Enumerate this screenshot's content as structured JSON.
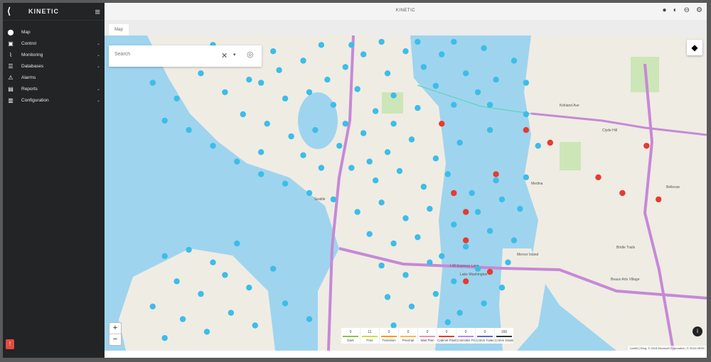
{
  "app": {
    "brand": "KINETIC",
    "title": "KINETIC"
  },
  "sidebar": {
    "items": [
      {
        "label": "Map",
        "icon": "map-pin-icon",
        "glyph": "⬤",
        "chevron": false
      },
      {
        "label": "Control",
        "icon": "control-icon",
        "glyph": "▣",
        "chevron": true
      },
      {
        "label": "Monitoring",
        "icon": "monitoring-icon",
        "glyph": "⌇",
        "chevron": true
      },
      {
        "label": "Databases",
        "icon": "database-icon",
        "glyph": "☰",
        "chevron": true
      },
      {
        "label": "Alarms",
        "icon": "alarm-icon",
        "glyph": "⚠",
        "chevron": false
      },
      {
        "label": "Reports",
        "icon": "report-icon",
        "glyph": "▤",
        "chevron": true
      },
      {
        "label": "Configuration",
        "icon": "configuration-icon",
        "glyph": "▥",
        "chevron": true
      }
    ]
  },
  "tabs": [
    {
      "label": "Map"
    }
  ],
  "search": {
    "placeholder": "Search"
  },
  "legend": [
    {
      "count": "0",
      "label": "Dark",
      "color": "#8bc34a"
    },
    {
      "count": "11",
      "label": "Free",
      "color": "#cddc39"
    },
    {
      "count": "0",
      "label": "Transition",
      "color": "#ff9800"
    },
    {
      "count": "0",
      "label": "Preempt",
      "color": "#ffb74d"
    },
    {
      "count": "0",
      "label": "Wait Plan",
      "color": "#f48fb1"
    },
    {
      "count": "0",
      "label": "Cabinet Flash",
      "color": "#e53935"
    },
    {
      "count": "0",
      "label": "Controller Flash",
      "color": "#b388ff"
    },
    {
      "count": "0",
      "label": "Comm Failed",
      "color": "#5c6bc0"
    },
    {
      "count": "160",
      "label": "Comm Disabled",
      "color": "#333333"
    }
  ],
  "map_labels": {
    "kirkland_area": "Kirkland Ave",
    "clyde_hill": "Clyde Hill",
    "medina": "Medina",
    "bellevue": "Bellevue",
    "seattle": "Seattle",
    "i90": "I-90 Express Lane",
    "lake_wash": "Lake Washington",
    "mercer": "Mercer Island",
    "bridle": "Bridle Trails",
    "beaux_arts": "Beaux Arts Village"
  },
  "attribution": "Leaflet | Bing, © 2018 Microsoft Corporation, © 2018 HERE",
  "controls": {
    "zoom_in": "+",
    "zoom_out": "−",
    "info": "i",
    "layers": "◆"
  },
  "colors": {
    "signal": "#3cbde8",
    "alarm": "#e53b2f",
    "water": "#9fd4ee",
    "land": "#efece4",
    "highway": "#c689d6"
  },
  "markers": {
    "blue": [
      [
        0.28,
        0.05
      ],
      [
        0.33,
        0.08
      ],
      [
        0.36,
        0.03
      ],
      [
        0.4,
        0.1
      ],
      [
        0.43,
        0.06
      ],
      [
        0.47,
        0.12
      ],
      [
        0.5,
        0.05
      ],
      [
        0.53,
        0.1
      ],
      [
        0.56,
        0.06
      ],
      [
        0.6,
        0.12
      ],
      [
        0.63,
        0.04
      ],
      [
        0.26,
        0.15
      ],
      [
        0.3,
        0.2
      ],
      [
        0.34,
        0.18
      ],
      [
        0.38,
        0.22
      ],
      [
        0.42,
        0.17
      ],
      [
        0.45,
        0.24
      ],
      [
        0.48,
        0.19
      ],
      [
        0.52,
        0.23
      ],
      [
        0.55,
        0.16
      ],
      [
        0.58,
        0.22
      ],
      [
        0.62,
        0.18
      ],
      [
        0.65,
        0.14
      ],
      [
        0.68,
        0.08
      ],
      [
        0.27,
        0.28
      ],
      [
        0.31,
        0.32
      ],
      [
        0.35,
        0.3
      ],
      [
        0.39,
        0.35
      ],
      [
        0.43,
        0.31
      ],
      [
        0.47,
        0.37
      ],
      [
        0.51,
        0.33
      ],
      [
        0.55,
        0.39
      ],
      [
        0.59,
        0.34
      ],
      [
        0.64,
        0.3
      ],
      [
        0.41,
        0.42
      ],
      [
        0.45,
        0.46
      ],
      [
        0.49,
        0.43
      ],
      [
        0.53,
        0.48
      ],
      [
        0.57,
        0.44
      ],
      [
        0.61,
        0.5
      ],
      [
        0.65,
        0.46
      ],
      [
        0.38,
        0.52
      ],
      [
        0.42,
        0.56
      ],
      [
        0.46,
        0.53
      ],
      [
        0.5,
        0.58
      ],
      [
        0.54,
        0.55
      ],
      [
        0.58,
        0.6
      ],
      [
        0.62,
        0.56
      ],
      [
        0.66,
        0.52
      ],
      [
        0.44,
        0.63
      ],
      [
        0.48,
        0.66
      ],
      [
        0.52,
        0.64
      ],
      [
        0.56,
        0.7
      ],
      [
        0.6,
        0.67
      ],
      [
        0.64,
        0.62
      ],
      [
        0.46,
        0.73
      ],
      [
        0.5,
        0.76
      ],
      [
        0.54,
        0.72
      ],
      [
        0.58,
        0.78
      ],
      [
        0.62,
        0.74
      ],
      [
        0.66,
        0.8
      ],
      [
        0.47,
        0.83
      ],
      [
        0.51,
        0.86
      ],
      [
        0.55,
        0.82
      ],
      [
        0.59,
        0.88
      ],
      [
        0.63,
        0.85
      ],
      [
        0.48,
        0.92
      ],
      [
        0.53,
        0.95
      ],
      [
        0.57,
        0.91
      ],
      [
        0.61,
        0.96
      ],
      [
        0.08,
        0.15
      ],
      [
        0.12,
        0.2
      ],
      [
        0.16,
        0.12
      ],
      [
        0.2,
        0.18
      ],
      [
        0.23,
        0.25
      ],
      [
        0.1,
        0.27
      ],
      [
        0.14,
        0.3
      ],
      [
        0.18,
        0.35
      ],
      [
        0.22,
        0.4
      ],
      [
        0.26,
        0.44
      ],
      [
        0.3,
        0.47
      ],
      [
        0.34,
        0.5
      ],
      [
        0.06,
        0.08
      ],
      [
        0.1,
        0.05
      ],
      [
        0.14,
        0.07
      ],
      [
        0.18,
        0.03
      ],
      [
        0.22,
        0.08
      ],
      [
        0.24,
        0.14
      ],
      [
        0.7,
        0.25
      ],
      [
        0.72,
        0.35
      ],
      [
        0.7,
        0.45
      ],
      [
        0.69,
        0.55
      ],
      [
        0.68,
        0.65
      ],
      [
        0.67,
        0.72
      ],
      [
        0.1,
        0.7
      ],
      [
        0.14,
        0.68
      ],
      [
        0.18,
        0.72
      ],
      [
        0.22,
        0.66
      ],
      [
        0.12,
        0.78
      ],
      [
        0.16,
        0.82
      ],
      [
        0.2,
        0.76
      ],
      [
        0.24,
        0.8
      ],
      [
        0.28,
        0.74
      ],
      [
        0.08,
        0.86
      ],
      [
        0.13,
        0.9
      ],
      [
        0.17,
        0.94
      ],
      [
        0.21,
        0.88
      ],
      [
        0.25,
        0.92
      ],
      [
        0.3,
        0.85
      ],
      [
        0.34,
        0.9
      ],
      [
        0.1,
        0.96
      ],
      [
        0.4,
        0.28
      ],
      [
        0.44,
        0.4
      ],
      [
        0.48,
        0.28
      ],
      [
        0.36,
        0.42
      ],
      [
        0.29,
        0.11
      ],
      [
        0.46,
        0.02
      ],
      [
        0.52,
        0.02
      ],
      [
        0.58,
        0.02
      ],
      [
        0.64,
        0.22
      ],
      [
        0.7,
        0.15
      ],
      [
        0.33,
        0.38
      ],
      [
        0.37,
        0.14
      ],
      [
        0.41,
        0.03
      ],
      [
        0.26,
        0.37
      ]
    ],
    "red": [
      [
        0.56,
        0.28
      ],
      [
        0.65,
        0.44
      ],
      [
        0.58,
        0.5
      ],
      [
        0.6,
        0.56
      ],
      [
        0.6,
        0.65
      ],
      [
        0.6,
        0.78
      ],
      [
        0.64,
        0.75
      ],
      [
        0.7,
        0.3
      ],
      [
        0.74,
        0.34
      ],
      [
        0.9,
        0.35
      ],
      [
        0.82,
        0.45
      ],
      [
        0.86,
        0.5
      ],
      [
        0.92,
        0.52
      ]
    ]
  }
}
